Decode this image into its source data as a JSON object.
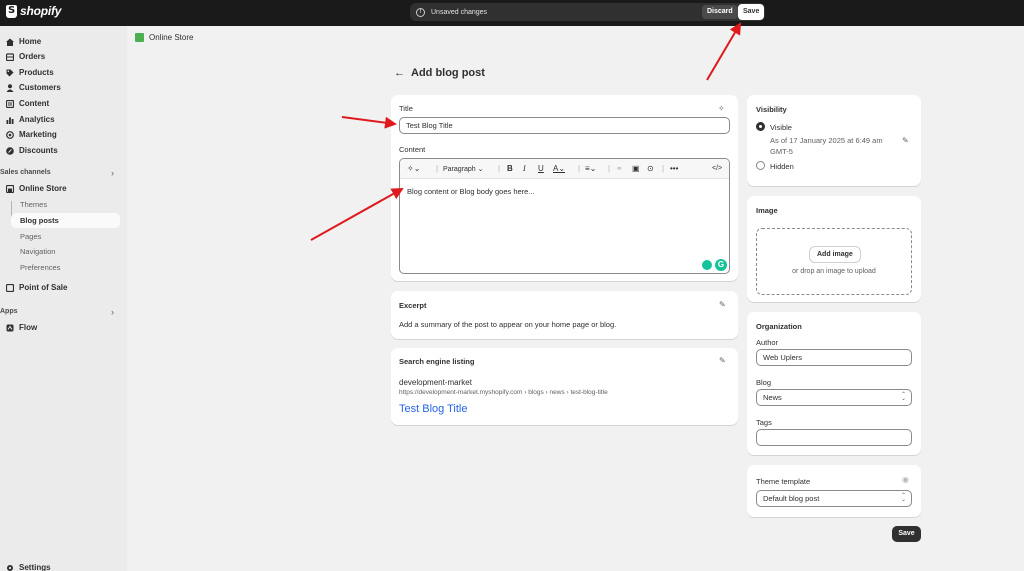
{
  "topbar": {
    "brand": "shopify",
    "unsaved_message": "Unsaved changes",
    "discard_label": "Discard",
    "save_label": "Save"
  },
  "sidebar": {
    "items": [
      {
        "label": "Home",
        "icon": "home-icon"
      },
      {
        "label": "Orders",
        "icon": "orders-icon"
      },
      {
        "label": "Products",
        "icon": "tag-icon"
      },
      {
        "label": "Customers",
        "icon": "person-icon"
      },
      {
        "label": "Content",
        "icon": "content-icon"
      },
      {
        "label": "Analytics",
        "icon": "chart-icon"
      },
      {
        "label": "Marketing",
        "icon": "target-icon"
      },
      {
        "label": "Discounts",
        "icon": "discount-icon"
      }
    ],
    "sales_channels_label": "Sales channels",
    "online_store_label": "Online Store",
    "online_store_sub": [
      "Themes",
      "Blog posts",
      "Pages",
      "Navigation",
      "Preferences"
    ],
    "point_of_sale_label": "Point of Sale",
    "apps_label": "Apps",
    "flow_label": "Flow",
    "settings_label": "Settings"
  },
  "breadcrumb": {
    "label": "Online Store"
  },
  "page": {
    "title": "Add blog post"
  },
  "post": {
    "title_label": "Title",
    "title_value": "Test Blog Title",
    "content_label": "Content",
    "paragraph_label": "Paragraph",
    "content_value": "Blog content or Blog body goes here..."
  },
  "excerpt": {
    "heading": "Excerpt",
    "description": "Add a summary of the post to appear on your home page or blog."
  },
  "seo": {
    "heading": "Search engine listing",
    "store_name": "development-market",
    "url": "https://development-market.myshopify.com › blogs › news › test-blog-title",
    "title": "Test Blog Title"
  },
  "visibility": {
    "heading": "Visibility",
    "visible_label": "Visible",
    "visible_date_line1": "As of 17 January 2025 at 6:49 am",
    "visible_date_line2": "GMT-5",
    "hidden_label": "Hidden",
    "selected": "Visible"
  },
  "image": {
    "heading": "Image",
    "add_label": "Add image",
    "drop_text": "or drop an image to upload"
  },
  "organization": {
    "heading": "Organization",
    "author_label": "Author",
    "author_value": "Web Uplers",
    "blog_label": "Blog",
    "blog_value": "News",
    "tags_label": "Tags",
    "tags_value": ""
  },
  "theme_template": {
    "heading": "Theme template",
    "value": "Default blog post"
  },
  "footer": {
    "save_label": "Save"
  },
  "colors": {
    "annotation_arrow": "#e0191c",
    "link": "#2463eb",
    "grammarly": "#15c39a"
  }
}
